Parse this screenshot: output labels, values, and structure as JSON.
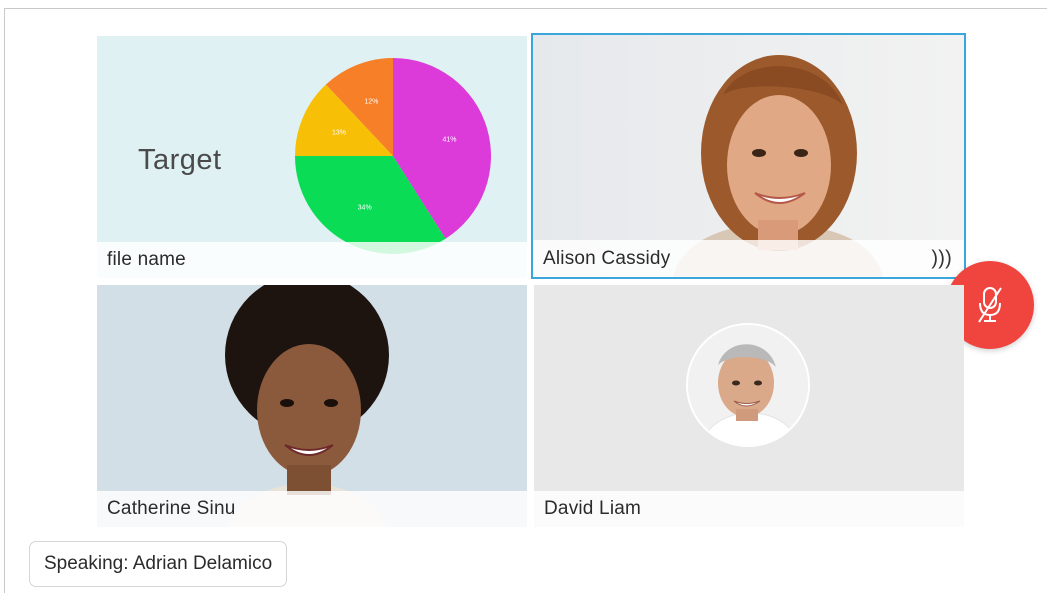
{
  "share": {
    "slide_title": "Target",
    "file_label": "file name",
    "pie": [
      {
        "label": "41%",
        "value": 41,
        "color": "#dc3ad9"
      },
      {
        "label": "34%",
        "value": 34,
        "color": "#0adc56"
      },
      {
        "label": "13%",
        "value": 13,
        "color": "#f8bf07"
      },
      {
        "label": "12%",
        "value": 12,
        "color": "#f77f27"
      }
    ]
  },
  "participants": [
    {
      "name": "Alison Cassidy",
      "speaking": true
    },
    {
      "name": "Catherine Sinu",
      "speaking": false
    },
    {
      "name": "David Liam",
      "speaking": false
    }
  ],
  "controls": {
    "mute_icon": "mic-off-icon",
    "mute_color": "#f0453f"
  },
  "status": {
    "speaking_text": "Speaking: Adrian Delamico"
  },
  "colors": {
    "active_border": "#3ba6db"
  }
}
